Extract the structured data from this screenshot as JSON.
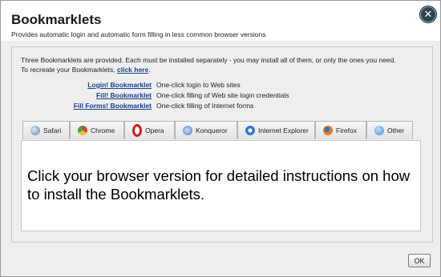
{
  "dialog": {
    "title": "Bookmarklets",
    "subtitle": "Provides automatic login and automatic form filling in less common browser versions",
    "close_icon": "close-circle-icon",
    "ok_label": "OK"
  },
  "intro": {
    "line1": "Three Bookmarklets are provided. Each must be installed separately - you may install all of them, or only the ones you need.",
    "line2_prefix": "To recreate your Bookmarklets, ",
    "line2_link": "click here",
    "line2_suffix": "."
  },
  "bookmarklets": [
    {
      "name": "Login! Bookmarklet",
      "description": "One-click login to Web sites"
    },
    {
      "name": "Fill! Bookmarklet",
      "description": "One-click filling of Web site login credentials"
    },
    {
      "name": "Fill Forms! Bookmarklet",
      "description": "One-click filling of Internet forms"
    }
  ],
  "tabs": [
    {
      "label": "Safari",
      "icon": "safari-icon",
      "color": "#5a7fb0"
    },
    {
      "label": "Chrome",
      "icon": "chrome-icon",
      "color": "#d9442f"
    },
    {
      "label": "Opera",
      "icon": "opera-icon",
      "color": "#cc1e1e"
    },
    {
      "label": "Konqueror",
      "icon": "konqueror-icon",
      "color": "#3e74c9"
    },
    {
      "label": "Internet Explorer",
      "icon": "internet-explorer-icon",
      "color": "#2f76d2"
    },
    {
      "label": "Firefox",
      "icon": "firefox-icon",
      "color": "#e3762b"
    },
    {
      "label": "Other",
      "icon": "globe-icon",
      "color": "#3d8bd6"
    }
  ],
  "content": {
    "message": "Click your browser version for detailed instructions on how to install the Bookmarklets."
  },
  "colors": {
    "link": "#1a3f8a",
    "close_button": "#2f4450"
  }
}
